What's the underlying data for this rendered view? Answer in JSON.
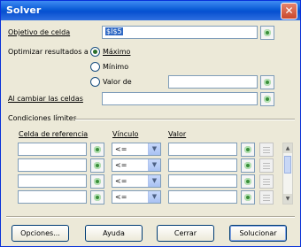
{
  "window": {
    "title": "Solver",
    "close_glyph": "✕"
  },
  "objective": {
    "label": "Objetivo de celda",
    "value": "$I$5"
  },
  "optimize": {
    "label": "Optimizar resultados a",
    "options": [
      {
        "label": "Máximo",
        "selected": true
      },
      {
        "label": "Mínimo",
        "selected": false
      },
      {
        "label": "Valor de",
        "selected": false
      }
    ],
    "value_of": ""
  },
  "changing_cells": {
    "label": "Al cambiar las celdas",
    "value": ""
  },
  "constraints": {
    "section_label": "Condiciones límites",
    "headers": {
      "ref": "Celda de referencia",
      "op": "Vínculo",
      "value": "Valor"
    },
    "rows": [
      {
        "ref": "",
        "op": "<=",
        "value": ""
      },
      {
        "ref": "",
        "op": "<=",
        "value": ""
      },
      {
        "ref": "",
        "op": "<=",
        "value": ""
      },
      {
        "ref": "",
        "op": "<=",
        "value": ""
      }
    ]
  },
  "buttons": {
    "options": "Opciones...",
    "help": "Ayuda",
    "close": "Cerrar",
    "solve": "Solucionar"
  }
}
